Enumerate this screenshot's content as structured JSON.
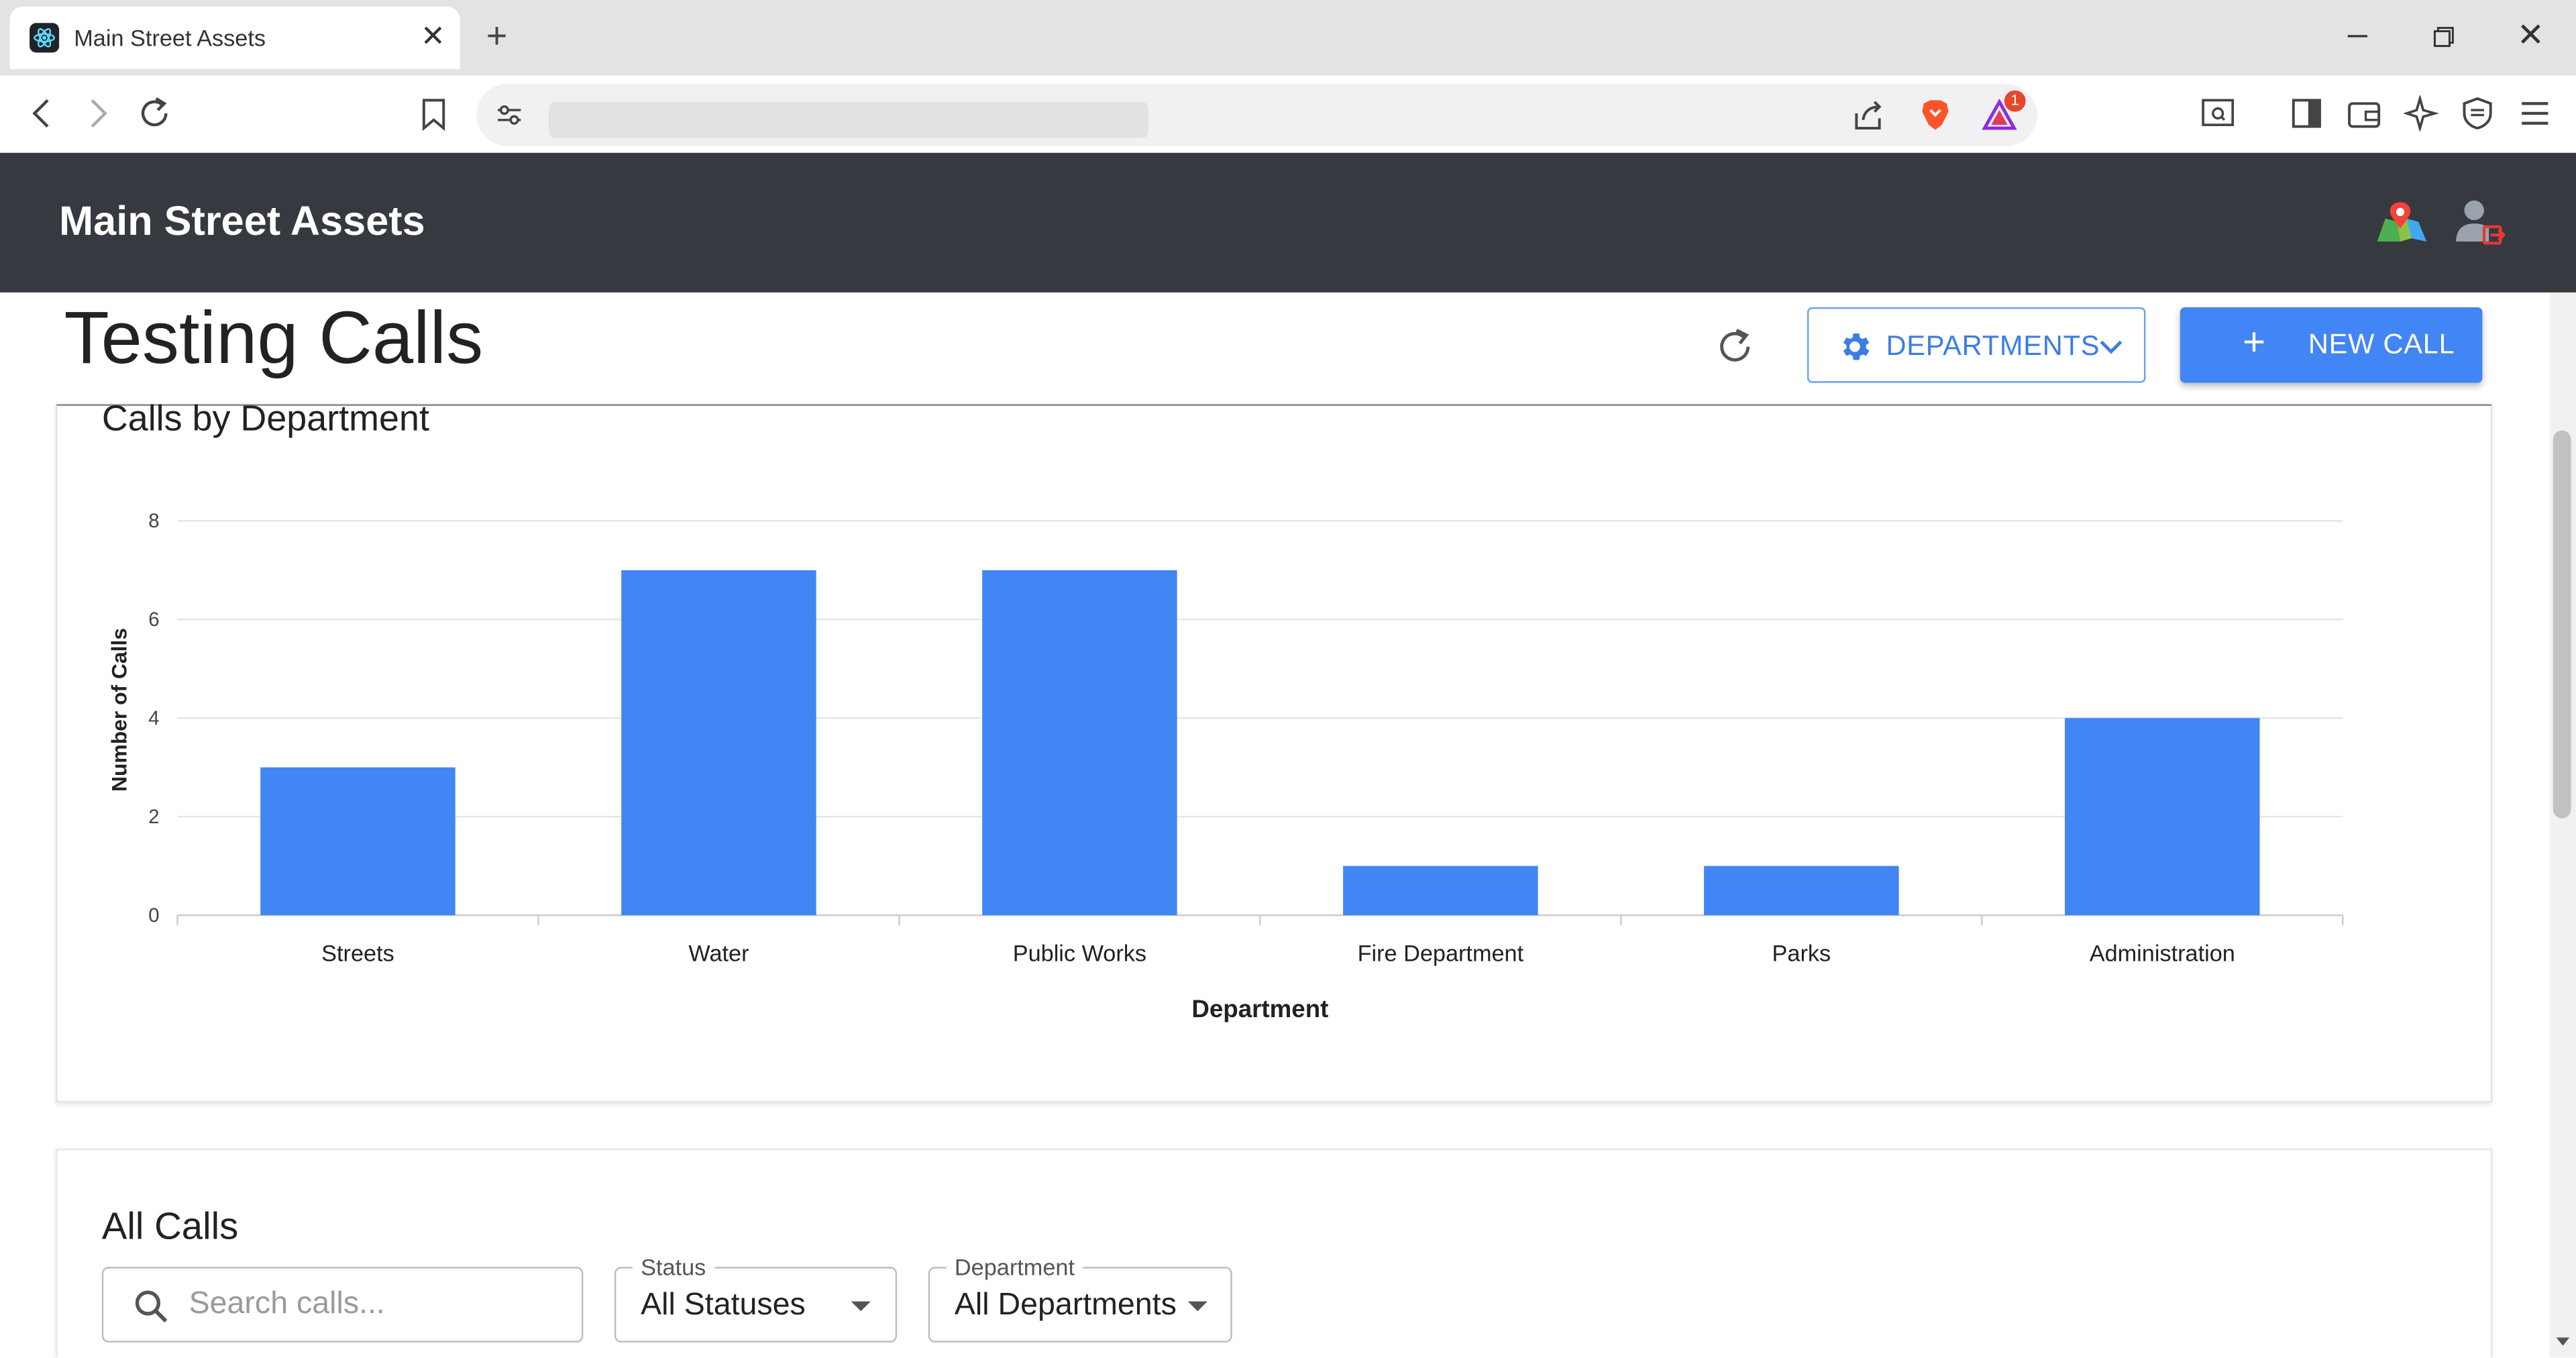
{
  "browser": {
    "tab_title": "Main Street Assets",
    "tab_close": "✕",
    "new_tab": "+",
    "close_window": "✕",
    "shields_badge": "1"
  },
  "app": {
    "title": "Main Street Assets"
  },
  "page": {
    "title": "Testing Calls",
    "departments_button": "DEPARTMENTS",
    "new_call_button": "NEW CALL",
    "new_call_plus": "+"
  },
  "chart_data": {
    "type": "bar",
    "title": "Calls by Department",
    "xlabel": "Department",
    "ylabel": "Number of Calls",
    "categories": [
      "Streets",
      "Water",
      "Public Works",
      "Fire Department",
      "Parks",
      "Administration"
    ],
    "values": [
      3,
      7,
      7,
      1,
      1,
      4
    ],
    "ylim": [
      0,
      8
    ],
    "yticks": [
      0,
      2,
      4,
      6,
      8
    ],
    "bar_color": "#4285f4",
    "grid": true,
    "legend": "none"
  },
  "calls": {
    "title": "All Calls",
    "search_placeholder": "Search calls...",
    "status_label": "Status",
    "status_value": "All Statuses",
    "department_label": "Department",
    "department_value": "All Departments"
  },
  "colors": {
    "header_bg": "#363940",
    "accent": "#4285f4"
  }
}
